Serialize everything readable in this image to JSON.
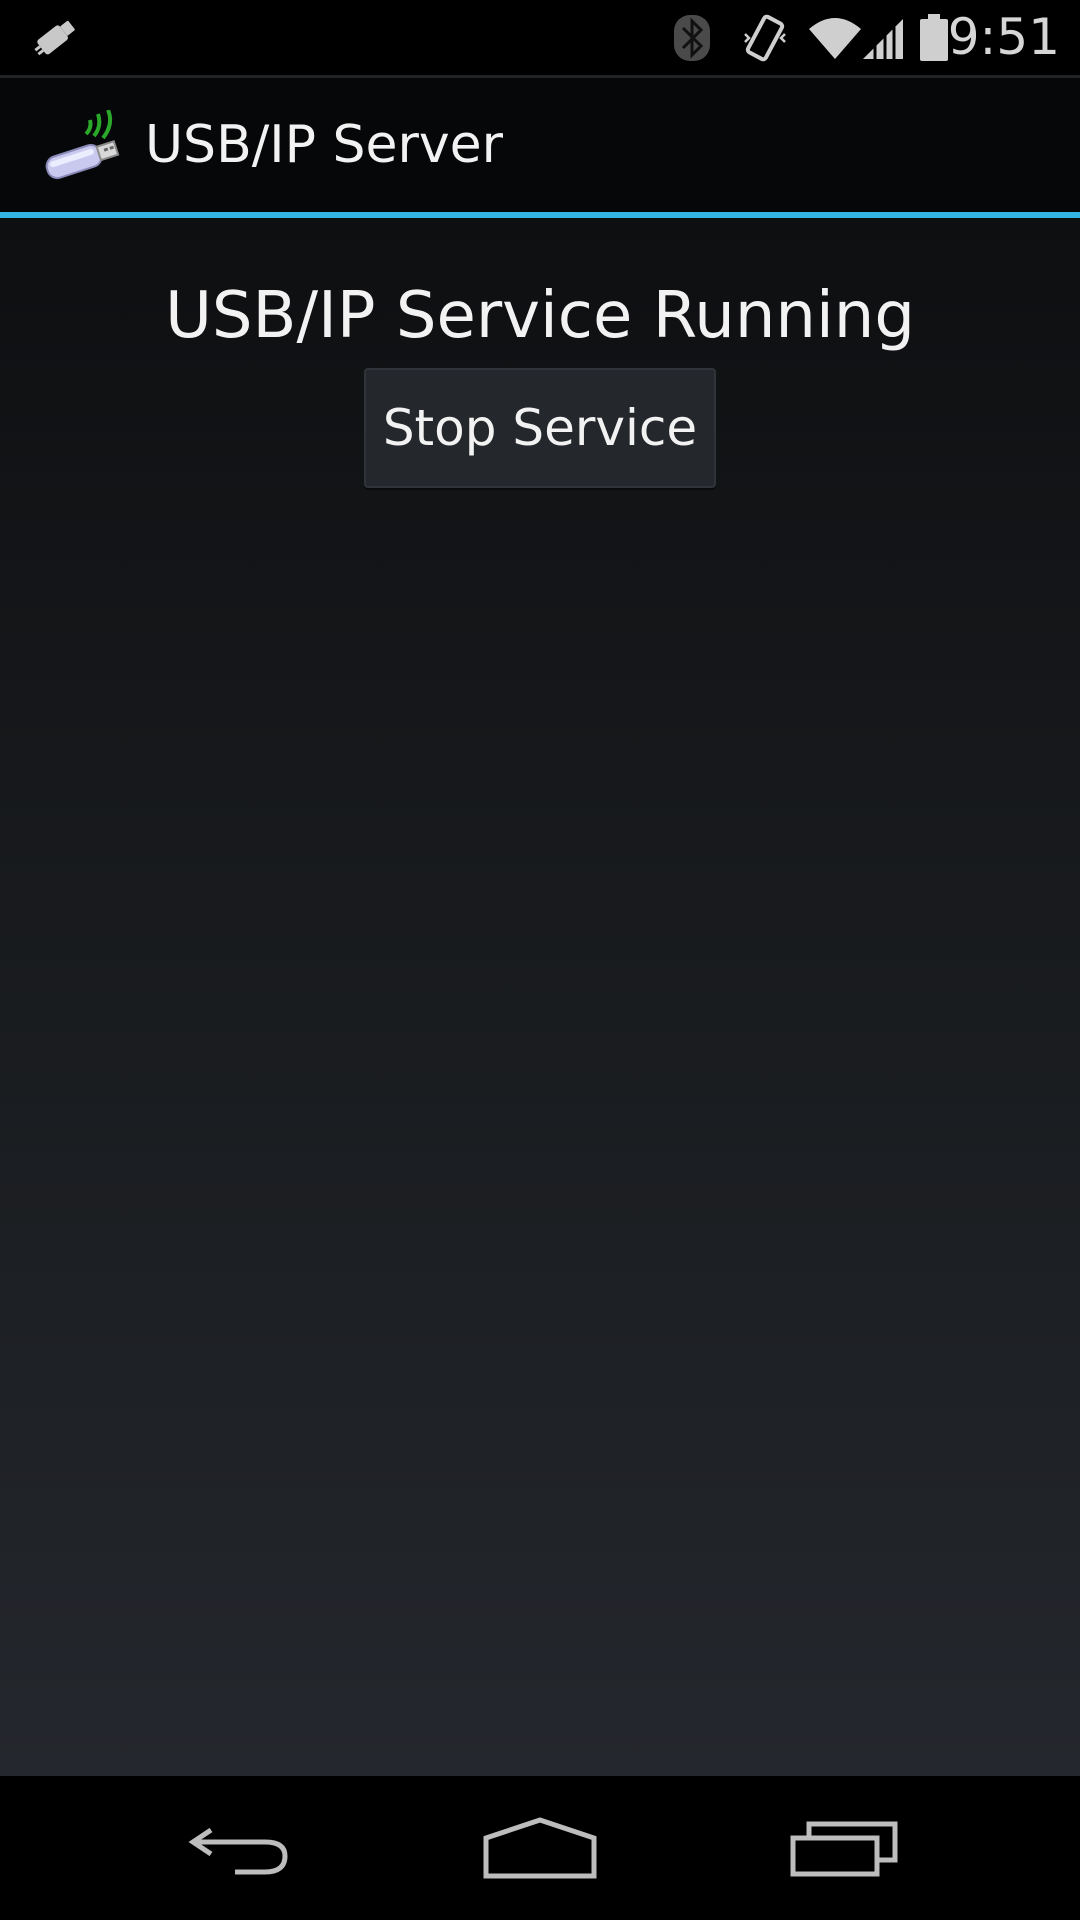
{
  "status_bar": {
    "time": "9:51",
    "icons": [
      "usb-debug-icon",
      "bluetooth-icon",
      "vibrate-icon",
      "wifi-icon",
      "signal-icon",
      "battery-icon"
    ]
  },
  "action_bar": {
    "title": "USB/IP Server",
    "icon": "usb-wireless-app-icon",
    "accent_color": "#33b5e5"
  },
  "main": {
    "status_message": "USB/IP Service Running",
    "stop_button_label": "Stop Service"
  },
  "nav_bar": {
    "buttons": [
      "back-icon",
      "home-icon",
      "recents-icon"
    ]
  }
}
